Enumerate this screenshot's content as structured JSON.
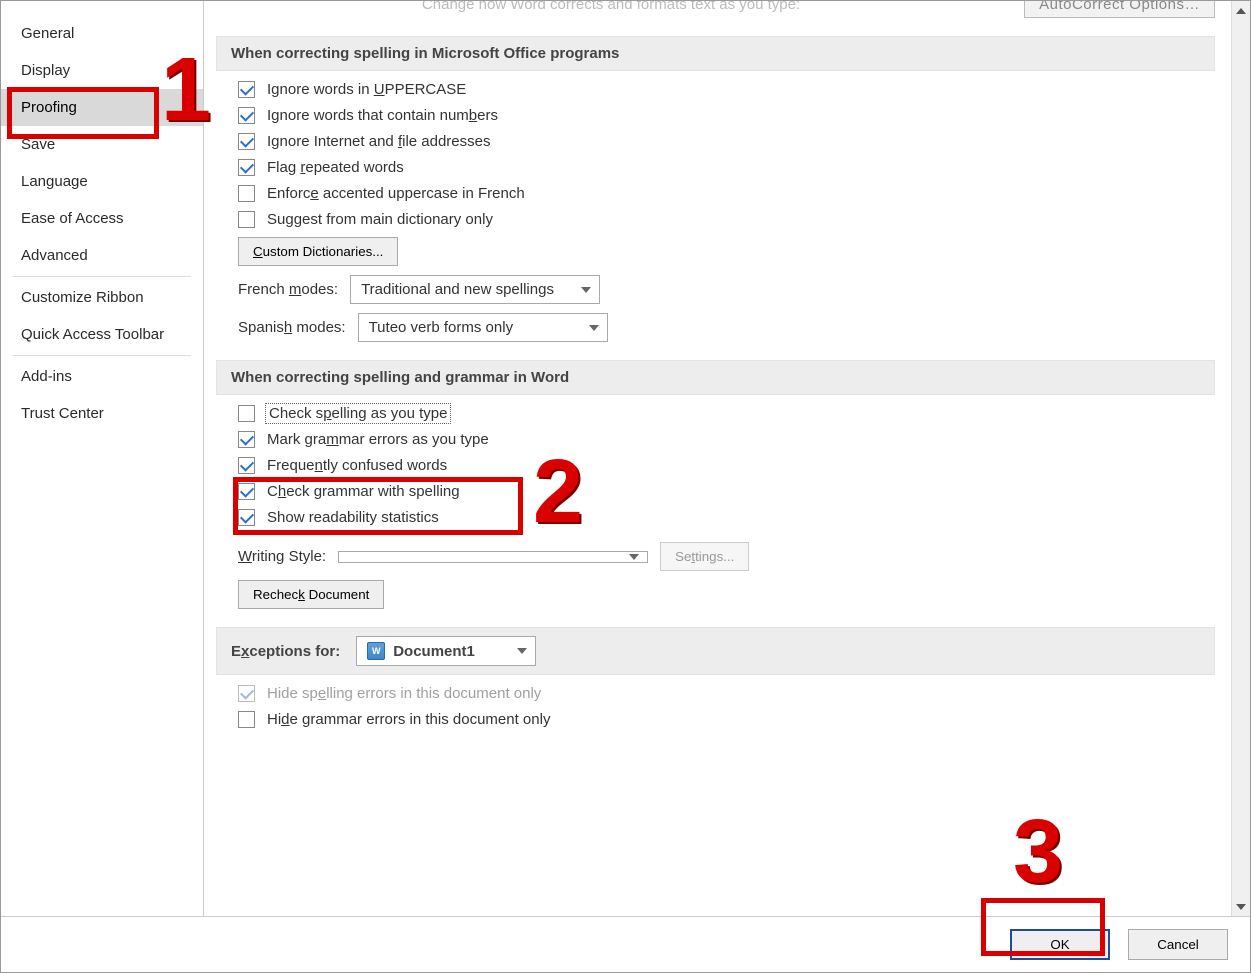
{
  "sidebar": {
    "items": [
      "General",
      "Display",
      "Proofing",
      "Save",
      "Language",
      "Ease of Access",
      "Advanced"
    ],
    "items2": [
      "Customize Ribbon",
      "Quick Access Toolbar"
    ],
    "items3": [
      "Add-ins",
      "Trust Center"
    ],
    "selected": "Proofing"
  },
  "topbar": {
    "ghost_label": "Change how Word corrects and formats text as you type:",
    "autocorrect_btn": "AutoCorrect Options…"
  },
  "section1": {
    "title": "When correcting spelling in Microsoft Office programs",
    "o1": "Ignore words in UPPERCASE",
    "o2": "Ignore words that contain numbers",
    "o3": "Ignore Internet and file addresses",
    "o4": "Flag repeated words",
    "o5": "Enforce accented uppercase in French",
    "o6": "Suggest from main dictionary only",
    "custom_dict_btn": "Custom Dictionaries...",
    "french_label": "French modes:",
    "french_value": "Traditional and new spellings",
    "spanish_label": "Spanish modes:",
    "spanish_value": "Tuteo verb forms only"
  },
  "section2": {
    "title": "When correcting spelling and grammar in Word",
    "o1": "Check spelling as you type",
    "o2": "Mark grammar errors as you type",
    "o3": "Frequently confused words",
    "o4": "Check grammar with spelling",
    "o5": "Show readability statistics",
    "writing_style_label": "Writing Style:",
    "settings_btn": "Settings...",
    "recheck_btn": "Recheck Document"
  },
  "section3": {
    "title": "Exceptions for:",
    "doc_value": "Document1",
    "o1": "Hide spelling errors in this document only",
    "o2": "Hide grammar errors in this document only"
  },
  "footer": {
    "ok": "OK",
    "cancel": "Cancel"
  },
  "annotations": {
    "n1": "1",
    "n2": "2",
    "n3": "3"
  }
}
